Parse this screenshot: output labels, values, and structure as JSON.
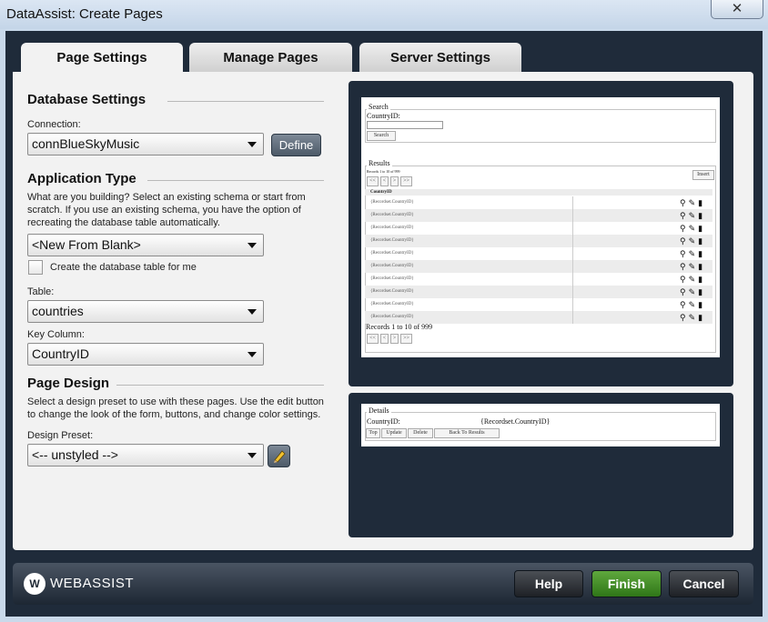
{
  "window": {
    "title": "DataAssist: Create Pages",
    "close_glyph": "✕"
  },
  "tabs": [
    {
      "label": "Page Settings",
      "active": true
    },
    {
      "label": "Manage Pages",
      "active": false
    },
    {
      "label": "Server Settings",
      "active": false
    }
  ],
  "database": {
    "section_title": "Database Settings",
    "connection_label": "Connection:",
    "connection_value": "connBlueSkyMusic",
    "define_label": "Define"
  },
  "application": {
    "section_title": "Application Type",
    "description": "What are you building? Select an existing schema or start from scratch. If you use an existing schema, you have the option of recreating the database table automatically.",
    "type_value": "<New From Blank>",
    "create_table_label": "Create the database table for me",
    "create_table_checked": false,
    "table_label": "Table:",
    "table_value": "countries",
    "key_label": "Key Column:",
    "key_value": "CountryID"
  },
  "design": {
    "section_title": "Page Design",
    "description": "Select a design preset to use with these pages. Use the edit button to change the look of the form, buttons, and change color settings.",
    "preset_label": "Design Preset:",
    "preset_value": "<-- unstyled -->",
    "edit_icon": "pencil-icon"
  },
  "preview_results": {
    "search_legend": "Search",
    "search_field_label": "CountryID:",
    "search_button": "Search",
    "results_legend": "Results",
    "records_small": "Records 1 to 10 of 999",
    "nav_buttons": [
      "<<",
      "<",
      ">",
      ">>"
    ],
    "insert_button": "Insert",
    "column_header": "CountryID",
    "rows": [
      "{Recordset.CountryID}",
      "{Recordset.CountryID}",
      "{Recordset.CountryID}",
      "{Recordset.CountryID}",
      "{Recordset.CountryID}",
      "{Recordset.CountryID}",
      "{Recordset.CountryID}",
      "{Recordset.CountryID}",
      "{Recordset.CountryID}",
      "{Recordset.CountryID}"
    ],
    "row_icons": [
      "search-icon",
      "edit-icon",
      "delete-icon"
    ],
    "records_text": "Records 1 to 10 of 999"
  },
  "preview_details": {
    "legend": "Details",
    "field_label": "CountryID:",
    "field_value": "{Recordset.CountryID}",
    "buttons": [
      "Top",
      "Update",
      "Delete",
      "Back To Results"
    ]
  },
  "footer": {
    "logo_mark": "W",
    "logo_text": "WEBASSIST",
    "help_label": "Help",
    "finish_label": "Finish",
    "cancel_label": "Cancel"
  }
}
